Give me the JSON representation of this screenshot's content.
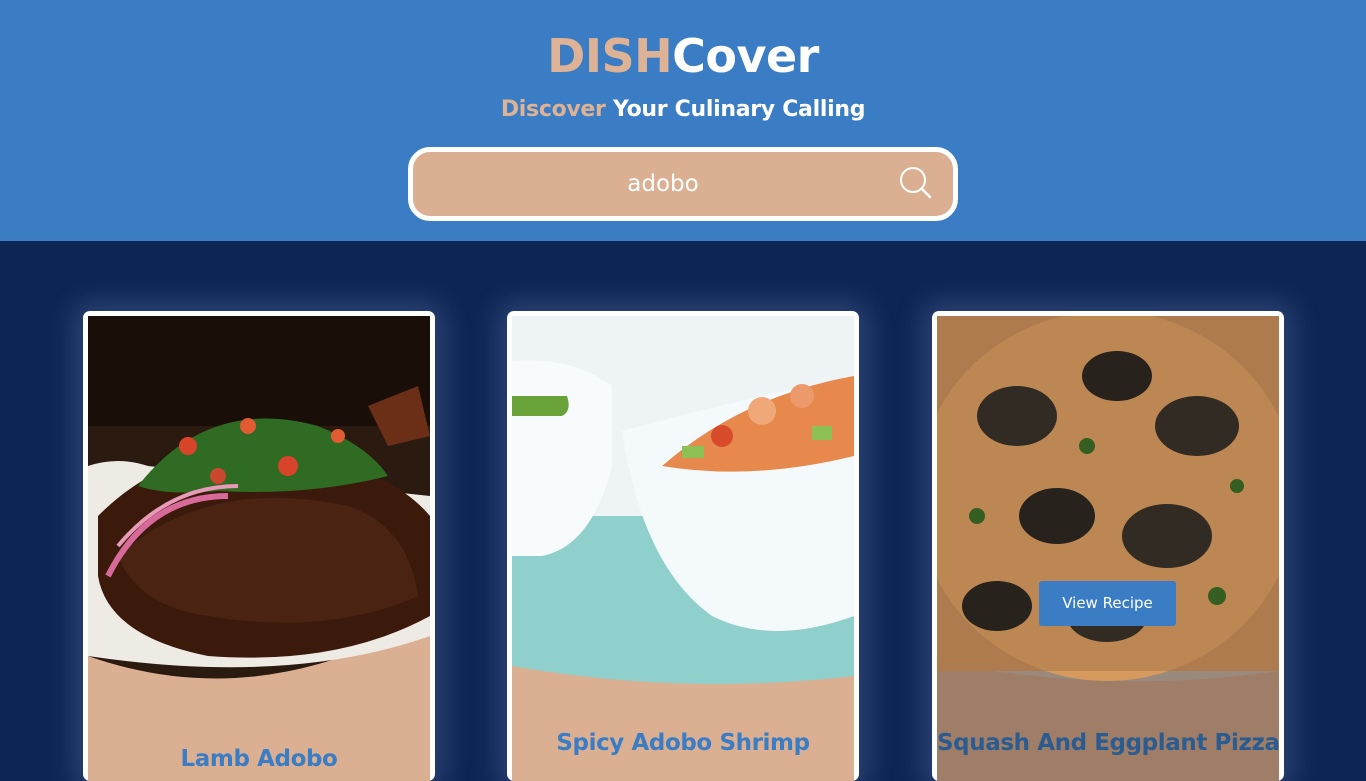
{
  "header": {
    "logo_part1": "DISH",
    "logo_part2": "Cover",
    "tagline_part1": "Discover",
    "tagline_part2": " Your Culinary Calling"
  },
  "search": {
    "value": "adobo",
    "icon": "search-icon"
  },
  "colors": {
    "header_bg": "#3a7dc4",
    "accent_tan": "#deb294",
    "page_bg": "#0d2553",
    "title_blue": "#3a7dc4"
  },
  "recipes": [
    {
      "title": "Lamb Adobo",
      "image": "braised-lamb-with-salsa"
    },
    {
      "title": "Spicy Adobo Shrimp",
      "image": "shrimp-salad-in-white-bowl"
    },
    {
      "title": "Squash And Eggplant Pizza",
      "image": "eggplant-pizza",
      "hover_button": "View Recipe"
    }
  ]
}
